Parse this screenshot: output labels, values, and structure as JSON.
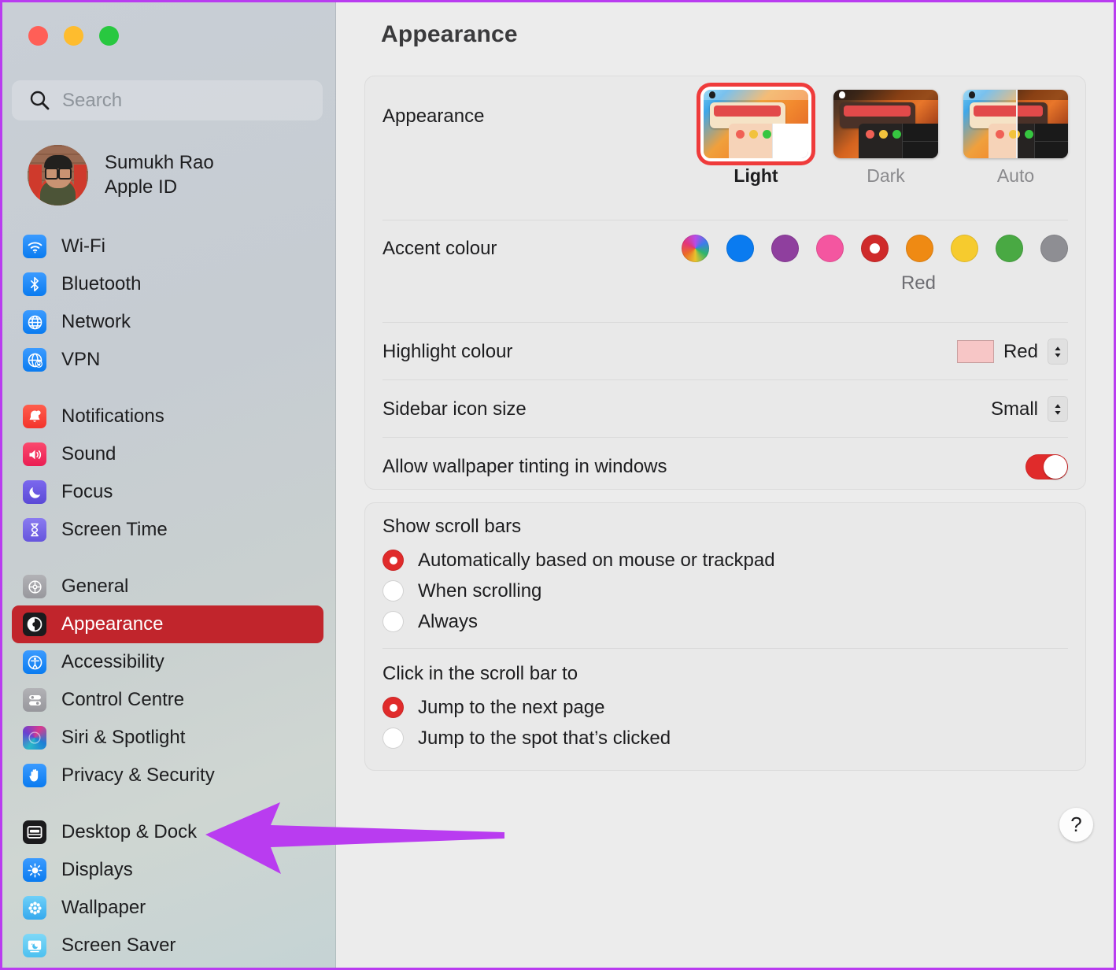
{
  "window": {
    "traffic_lights": [
      "close",
      "minimize",
      "maximize"
    ]
  },
  "sidebar": {
    "search": {
      "placeholder": "Search",
      "value": "",
      "icon": "search-icon"
    },
    "profile": {
      "name": "Sumukh Rao",
      "subtitle": "Apple ID",
      "avatar": "user-avatar"
    },
    "groups": [
      {
        "items": [
          {
            "label": "Wi-Fi",
            "icon": "wifi-icon",
            "selected": false
          },
          {
            "label": "Bluetooth",
            "icon": "bluetooth-icon",
            "selected": false
          },
          {
            "label": "Network",
            "icon": "network-icon",
            "selected": false
          },
          {
            "label": "VPN",
            "icon": "vpn-icon",
            "selected": false
          }
        ]
      },
      {
        "items": [
          {
            "label": "Notifications",
            "icon": "notifications-icon",
            "selected": false
          },
          {
            "label": "Sound",
            "icon": "sound-icon",
            "selected": false
          },
          {
            "label": "Focus",
            "icon": "focus-moon-icon",
            "selected": false
          },
          {
            "label": "Screen Time",
            "icon": "hourglass-icon",
            "selected": false
          }
        ]
      },
      {
        "items": [
          {
            "label": "General",
            "icon": "gear-icon",
            "selected": false
          },
          {
            "label": "Appearance",
            "icon": "appearance-icon",
            "selected": true
          },
          {
            "label": "Accessibility",
            "icon": "accessibility-icon",
            "selected": false
          },
          {
            "label": "Control Centre",
            "icon": "control-centre-icon",
            "selected": false
          },
          {
            "label": "Siri & Spotlight",
            "icon": "siri-icon",
            "selected": false
          },
          {
            "label": "Privacy & Security",
            "icon": "hand-shield-icon",
            "selected": false
          }
        ]
      },
      {
        "items": [
          {
            "label": "Desktop & Dock",
            "icon": "desktop-dock-icon",
            "selected": false
          },
          {
            "label": "Displays",
            "icon": "displays-icon",
            "selected": false
          },
          {
            "label": "Wallpaper",
            "icon": "wallpaper-icon",
            "selected": false
          },
          {
            "label": "Screen Saver",
            "icon": "screen-saver-icon",
            "selected": false
          }
        ]
      }
    ]
  },
  "annotation": {
    "type": "arrow",
    "direction": "left",
    "color": "#b93cf0",
    "points_to": "Desktop & Dock"
  },
  "main": {
    "title": "Appearance",
    "appearance_row": {
      "label": "Appearance",
      "options": [
        {
          "name": "Light",
          "selected": true
        },
        {
          "name": "Dark",
          "selected": false
        },
        {
          "name": "Auto",
          "selected": false
        }
      ]
    },
    "accent_row": {
      "label": "Accent colour",
      "selected_name": "Red",
      "swatches": [
        {
          "name": "Multicolour",
          "color": "multicolour",
          "selected": false
        },
        {
          "name": "Blue",
          "color": "#0a7bf0",
          "selected": false
        },
        {
          "name": "Purple",
          "color": "#8f3f9e",
          "selected": false
        },
        {
          "name": "Pink",
          "color": "#f456a0",
          "selected": false
        },
        {
          "name": "Red",
          "color": "#cf2a2a",
          "selected": true
        },
        {
          "name": "Orange",
          "color": "#ef8a13",
          "selected": false
        },
        {
          "name": "Yellow",
          "color": "#f6cb2e",
          "selected": false
        },
        {
          "name": "Green",
          "color": "#49a943",
          "selected": false
        },
        {
          "name": "Graphite",
          "color": "#8e8e93",
          "selected": false
        }
      ]
    },
    "highlight_row": {
      "label": "Highlight colour",
      "value": "Red",
      "swatch_color": "#f7c6c6"
    },
    "sidebar_icon_row": {
      "label": "Sidebar icon size",
      "value": "Small"
    },
    "tinting_row": {
      "label": "Allow wallpaper tinting in windows",
      "enabled": true
    },
    "scroll_bars": {
      "title": "Show scroll bars",
      "options": [
        {
          "label": "Automatically based on mouse or trackpad",
          "selected": true
        },
        {
          "label": "When scrolling",
          "selected": false
        },
        {
          "label": "Always",
          "selected": false
        }
      ]
    },
    "click_scroll_bar": {
      "title": "Click in the scroll bar to",
      "options": [
        {
          "label": "Jump to the next page",
          "selected": true
        },
        {
          "label": "Jump to the spot that’s clicked",
          "selected": false
        }
      ]
    },
    "help_button": {
      "label": "?"
    }
  }
}
